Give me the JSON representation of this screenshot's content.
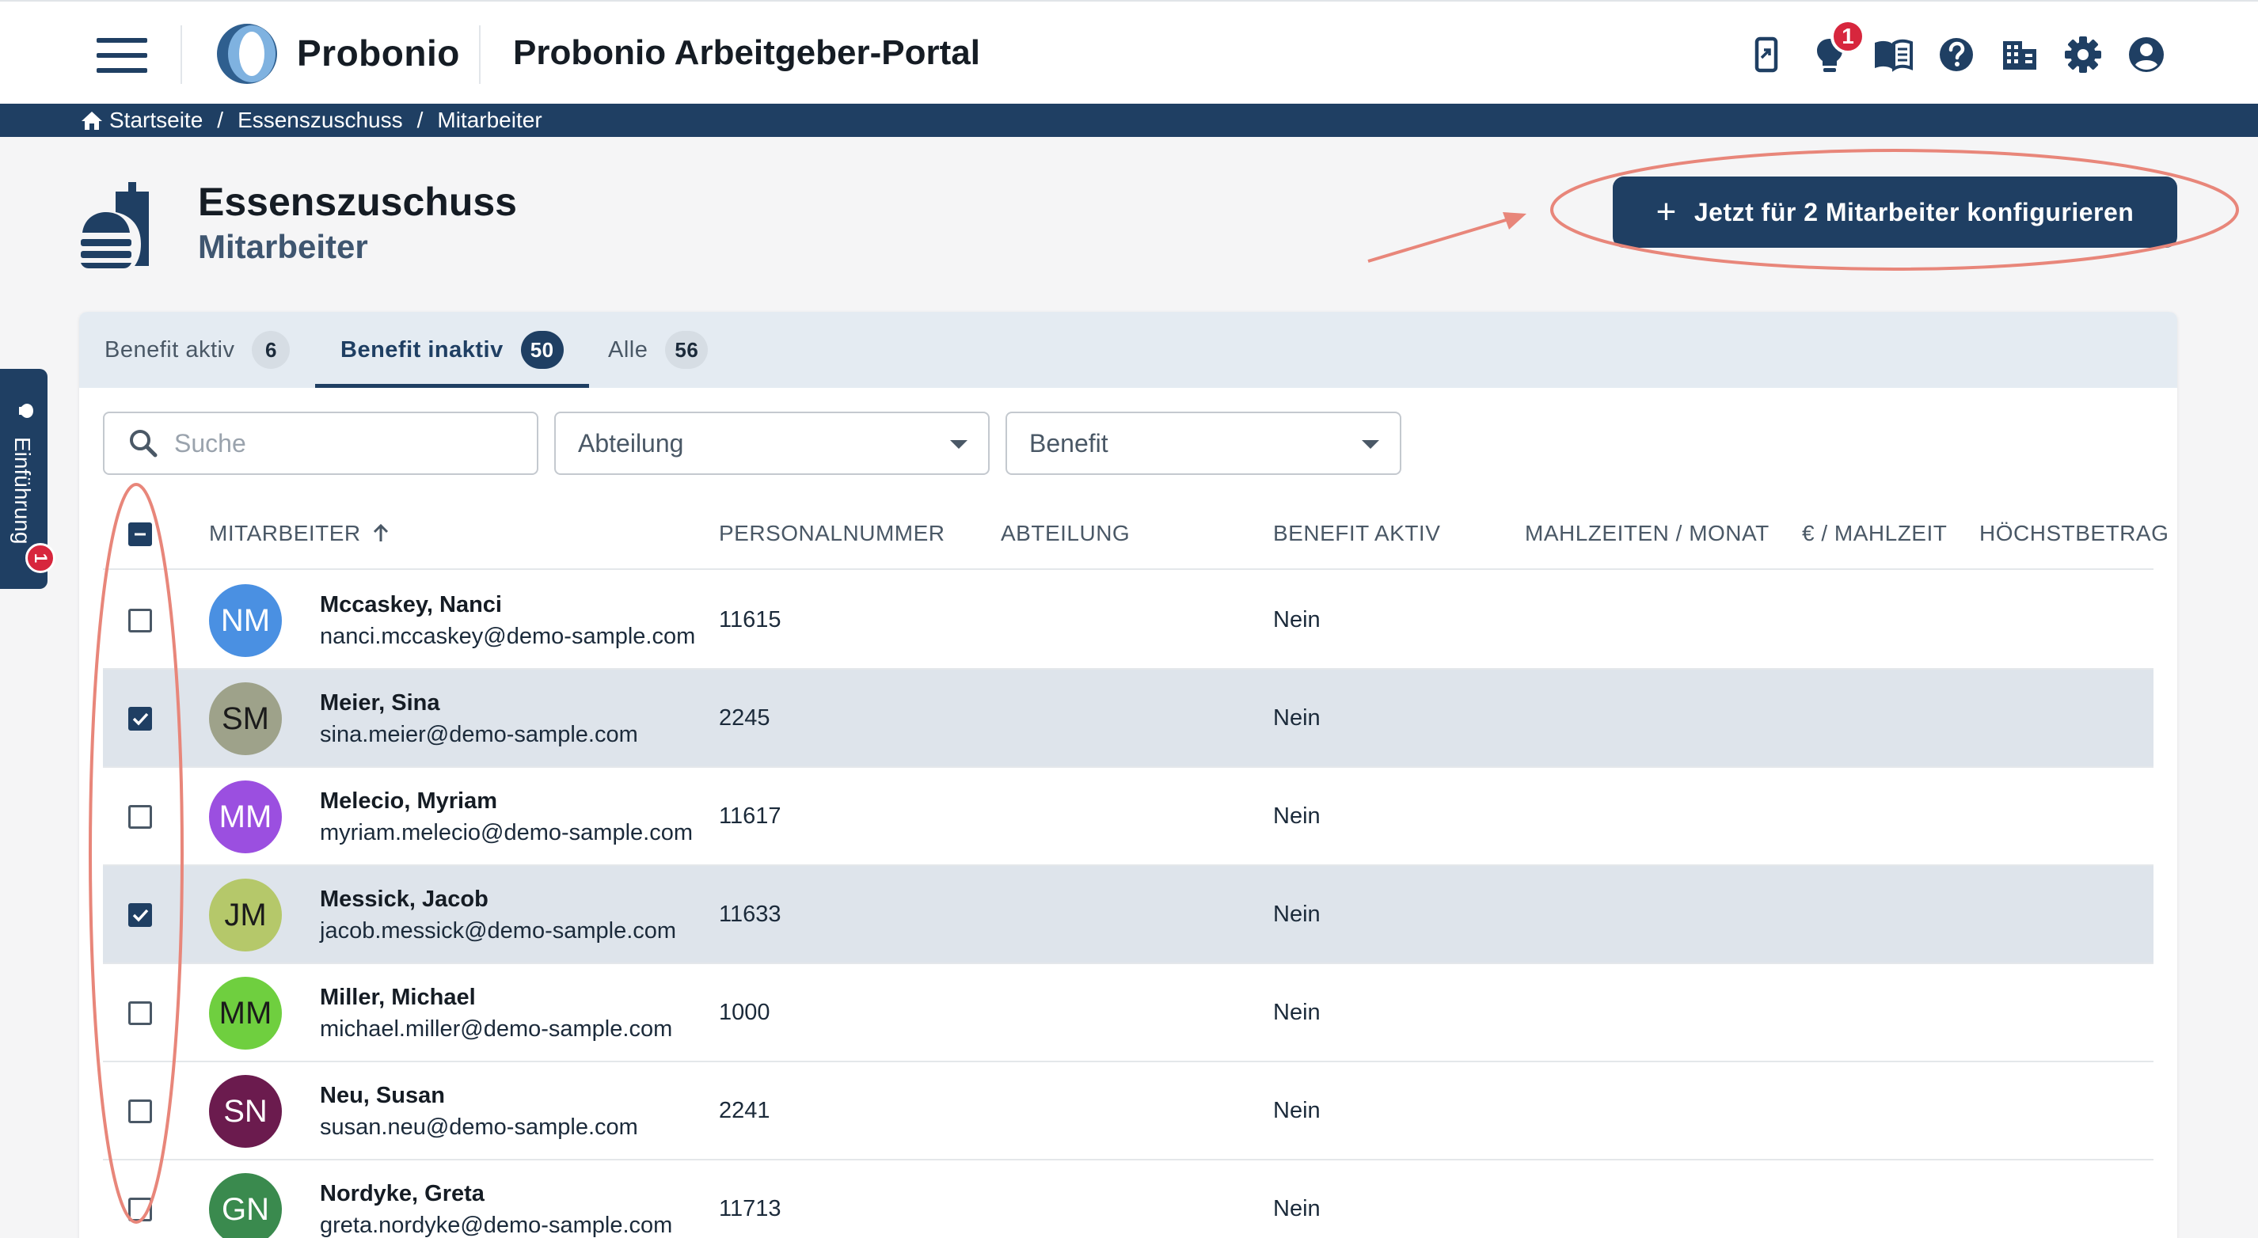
{
  "app": {
    "brand": "Probonio",
    "portal_title": "Probonio Arbeitgeber-Portal",
    "notification_count": "1",
    "icons": [
      "mobile-share-icon",
      "lightbulb-icon",
      "book-icon",
      "help-icon",
      "building-icon",
      "gear-icon",
      "account-icon"
    ]
  },
  "breadcrumb": [
    "Startseite",
    "Essenszuschuss",
    "Mitarbeiter"
  ],
  "page": {
    "title": "Essenszuschuss",
    "subtitle": "Mitarbeiter",
    "cta_label": "Jetzt für 2 Mitarbeiter konfigurieren"
  },
  "side_tab": {
    "label": "Einführung",
    "badge": "1"
  },
  "tabs": [
    {
      "label": "Benefit aktiv",
      "count": "6"
    },
    {
      "label": "Benefit inaktiv",
      "count": "50"
    },
    {
      "label": "Alle",
      "count": "56"
    }
  ],
  "filters": {
    "search_placeholder": "Suche",
    "department": "Abteilung",
    "benefit": "Benefit"
  },
  "table": {
    "columns": [
      "MITARBEITER",
      "PERSONALNUMMER",
      "ABTEILUNG",
      "BENEFIT AKTIV",
      "MAHLZEITEN / MONAT",
      "€ / MAHLZEIT",
      "HÖCHSTBETRAG"
    ],
    "rows": [
      {
        "initials": "NM",
        "name": "Mccaskey, Nanci",
        "email": "nanci.mccaskey@demo-sample.com",
        "personalnummer": "11615",
        "abteilung": "",
        "benefit_aktiv": "Nein",
        "selected": false,
        "avatar_color": "#4a90e2",
        "avatar_text_color": "#ffffff"
      },
      {
        "initials": "SM",
        "name": "Meier, Sina",
        "email": "sina.meier@demo-sample.com",
        "personalnummer": "2245",
        "abteilung": "",
        "benefit_aktiv": "Nein",
        "selected": true,
        "avatar_color": "#9ea28a",
        "avatar_text_color": "#1b1b1b"
      },
      {
        "initials": "MM",
        "name": "Melecio, Myriam",
        "email": "myriam.melecio@demo-sample.com",
        "personalnummer": "11617",
        "abteilung": "",
        "benefit_aktiv": "Nein",
        "selected": false,
        "avatar_color": "#9b4fe0",
        "avatar_text_color": "#ffffff"
      },
      {
        "initials": "JM",
        "name": "Messick, Jacob",
        "email": "jacob.messick@demo-sample.com",
        "personalnummer": "11633",
        "abteilung": "",
        "benefit_aktiv": "Nein",
        "selected": true,
        "avatar_color": "#b5c86a",
        "avatar_text_color": "#1b1b1b"
      },
      {
        "initials": "MM",
        "name": "Miller, Michael",
        "email": "michael.miller@demo-sample.com",
        "personalnummer": "1000",
        "abteilung": "",
        "benefit_aktiv": "Nein",
        "selected": false,
        "avatar_color": "#6fcf3f",
        "avatar_text_color": "#1b1b1b"
      },
      {
        "initials": "SN",
        "name": "Neu, Susan",
        "email": "susan.neu@demo-sample.com",
        "personalnummer": "2241",
        "abteilung": "",
        "benefit_aktiv": "Nein",
        "selected": false,
        "avatar_color": "#6b1b4e",
        "avatar_text_color": "#ffffff"
      },
      {
        "initials": "GN",
        "name": "Nordyke, Greta",
        "email": "greta.nordyke@demo-sample.com",
        "personalnummer": "11713",
        "abteilung": "",
        "benefit_aktiv": "Nein",
        "selected": false,
        "avatar_color": "#3a8a4e",
        "avatar_text_color": "#ffffff"
      }
    ]
  },
  "colors": {
    "primary": "#1f3f63",
    "badge_red": "#d7263d",
    "annotation": "#e8867a",
    "selected_row": "#dee4eb"
  }
}
